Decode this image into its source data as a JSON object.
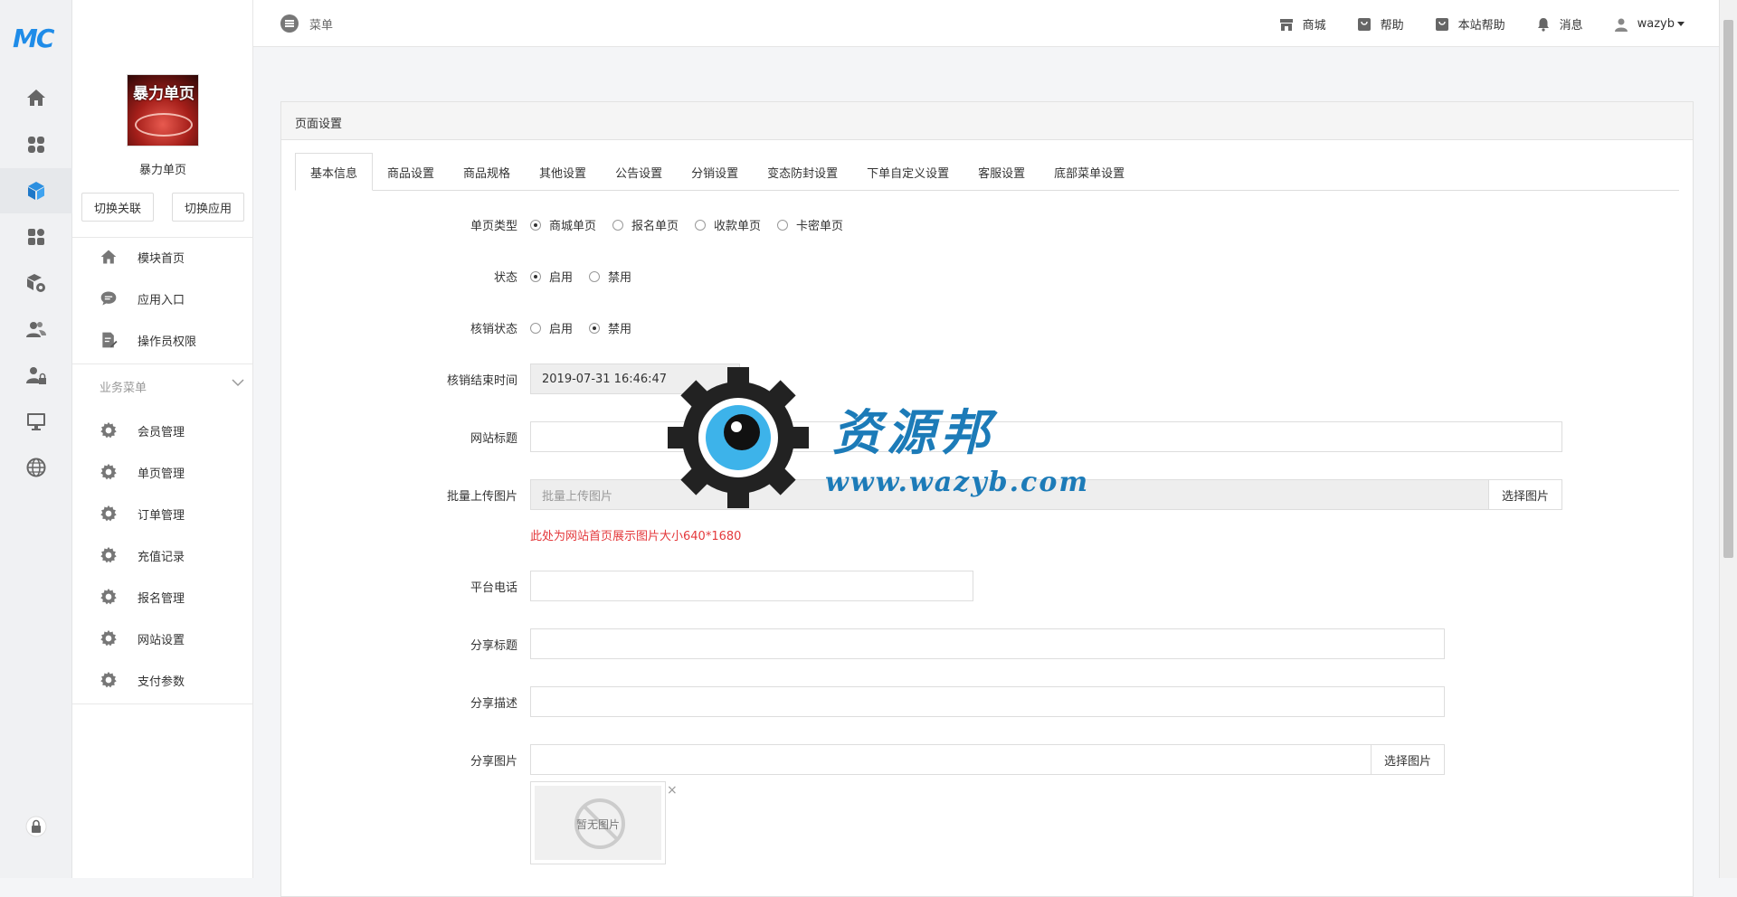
{
  "rail": {
    "logo": "MC",
    "icons": [
      "home-icon",
      "grid-icon",
      "cube-icon",
      "apps-icon",
      "box-gear-icon",
      "users-icon",
      "user-lock-icon",
      "monitor-icon",
      "globe-icon",
      "lock-icon"
    ],
    "active_index": 2
  },
  "sidebar": {
    "app_thumb_text": "暴力单页",
    "app_name": "暴力单页",
    "switch_link": "切换关联",
    "switch_app": "切换应用",
    "top_items": [
      {
        "label": "模块首页",
        "icon": "home-icon"
      },
      {
        "label": "应用入口",
        "icon": "chat-icon"
      },
      {
        "label": "操作员权限",
        "icon": "edit-doc-icon"
      }
    ],
    "section_title": "业务菜单",
    "business_items": [
      {
        "label": "会员管理",
        "icon": "gear-icon"
      },
      {
        "label": "单页管理",
        "icon": "gear-icon"
      },
      {
        "label": "订单管理",
        "icon": "gear-icon"
      },
      {
        "label": "充值记录",
        "icon": "gear-icon"
      },
      {
        "label": "报名管理",
        "icon": "gear-icon"
      },
      {
        "label": "网站设置",
        "icon": "gear-icon"
      },
      {
        "label": "支付参数",
        "icon": "gear-icon"
      }
    ]
  },
  "topbar": {
    "menu_label": "菜单",
    "links": [
      {
        "label": "商城",
        "icon": "store-icon"
      },
      {
        "label": "帮助",
        "icon": "bag-icon"
      },
      {
        "label": "本站帮助",
        "icon": "bag-icon"
      },
      {
        "label": "消息",
        "icon": "bell-icon"
      }
    ],
    "user": "wazyb"
  },
  "panel": {
    "title": "页面设置",
    "tabs": [
      "基本信息",
      "商品设置",
      "商品规格",
      "其他设置",
      "公告设置",
      "分销设置",
      "变态防封设置",
      "下单自定义设置",
      "客服设置",
      "底部菜单设置"
    ],
    "active_tab": 0
  },
  "form": {
    "page_type": {
      "label": "单页类型",
      "options": [
        "商城单页",
        "报名单页",
        "收款单页",
        "卡密单页"
      ],
      "selected": 0
    },
    "status": {
      "label": "状态",
      "options": [
        "启用",
        "禁用"
      ],
      "selected": 0
    },
    "verify_status": {
      "label": "核销状态",
      "options": [
        "启用",
        "禁用"
      ],
      "selected": 1
    },
    "verify_end": {
      "label": "核销结束时间",
      "value": "2019-07-31 16:46:47"
    },
    "site_title": {
      "label": "网站标题",
      "value": ""
    },
    "batch_upload": {
      "label": "批量上传图片",
      "placeholder": "批量上传图片",
      "button": "选择图片",
      "hint": "此处为网站首页展示图片大小640*1680"
    },
    "phone": {
      "label": "平台电话",
      "value": ""
    },
    "share_title": {
      "label": "分享标题",
      "value": ""
    },
    "share_desc": {
      "label": "分享描述",
      "value": ""
    },
    "share_image": {
      "label": "分享图片",
      "button": "选择图片",
      "preview_text": "暂无图片",
      "remove": "×"
    }
  },
  "watermark": {
    "name": "资源邦",
    "url": "www.wazyb.com"
  }
}
